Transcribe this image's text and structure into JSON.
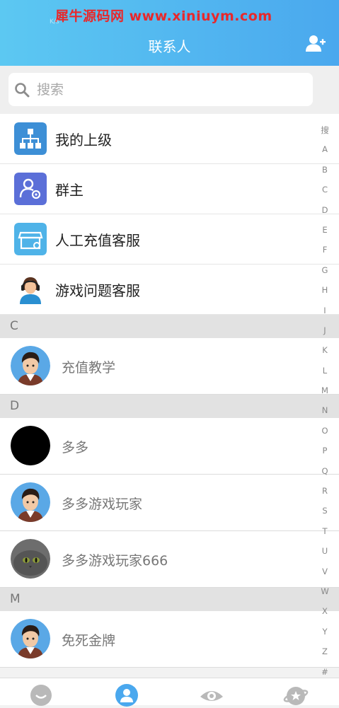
{
  "watermark": "犀牛源码网 www.xiniuym.com",
  "status": {
    "speed": "K/s"
  },
  "header": {
    "title": "联系人"
  },
  "search": {
    "placeholder": "搜索"
  },
  "fixed_items": [
    {
      "label": "我的上级",
      "icon": "hierarchy-icon",
      "color": "#3d8fd6"
    },
    {
      "label": "群主",
      "icon": "group-owner-icon",
      "color": "#5b6fd8"
    },
    {
      "label": "人工充值客服",
      "icon": "shop-service-icon",
      "color": "#4fb3e8"
    },
    {
      "label": "游戏问题客服",
      "icon": "headset-agent-icon",
      "color": "#2a8fd1"
    }
  ],
  "sections": [
    {
      "letter": "C",
      "contacts": [
        {
          "name": "充值教学",
          "avatar": "cartoon-boy"
        }
      ]
    },
    {
      "letter": "D",
      "contacts": [
        {
          "name": "多多",
          "avatar": "black-circle"
        },
        {
          "name": "多多游戏玩家",
          "avatar": "cartoon-boy"
        },
        {
          "name": "多多游戏玩家666",
          "avatar": "gray-cat"
        }
      ]
    },
    {
      "letter": "M",
      "contacts": [
        {
          "name": "免死金牌",
          "avatar": "cartoon-boy"
        }
      ]
    }
  ],
  "index_letters": [
    "搜",
    "A",
    "B",
    "C",
    "D",
    "E",
    "F",
    "G",
    "H",
    "I",
    "J",
    "K",
    "L",
    "M",
    "N",
    "O",
    "P",
    "Q",
    "R",
    "S",
    "T",
    "U",
    "V",
    "W",
    "X",
    "Y",
    "Z",
    "#"
  ],
  "tabs": [
    {
      "icon": "chat-icon",
      "active": false
    },
    {
      "icon": "contacts-icon",
      "active": true
    },
    {
      "icon": "discover-eye-icon",
      "active": false
    },
    {
      "icon": "planet-icon",
      "active": false
    }
  ],
  "colors": {
    "header_start": "#5cc8f2",
    "header_end": "#4aa8ee",
    "watermark": "#e8282b"
  }
}
